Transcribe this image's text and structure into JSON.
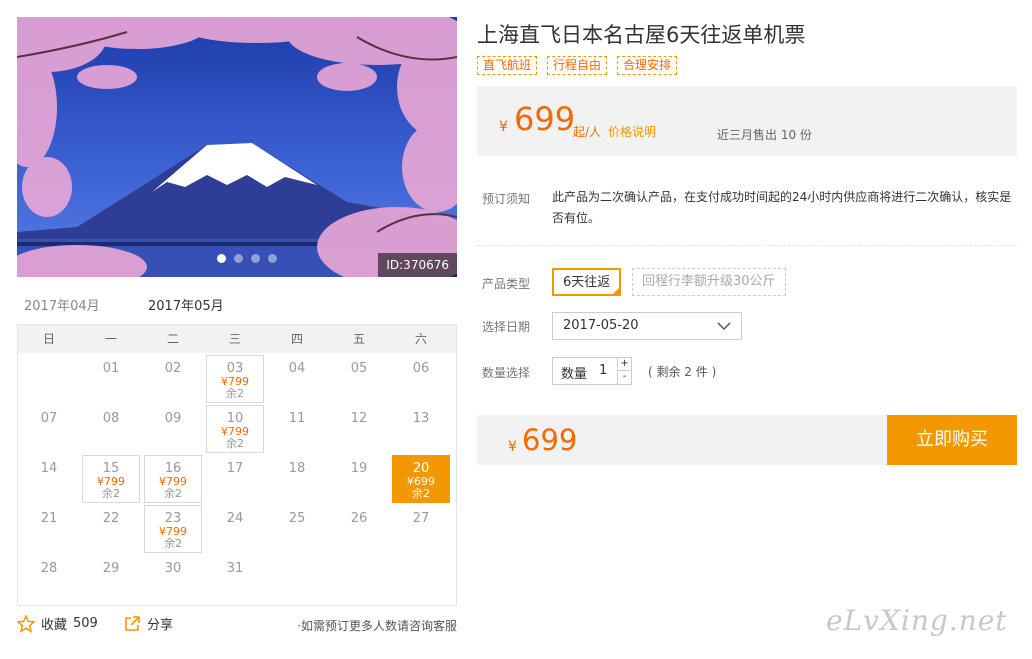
{
  "hero": {
    "image_id": "ID:370676",
    "slide_count": 4,
    "active_slide": 0
  },
  "months": [
    "2017年04月",
    "2017年05月"
  ],
  "active_month": 1,
  "weekdays": [
    "日",
    "一",
    "二",
    "三",
    "四",
    "五",
    "六"
  ],
  "calendar": {
    "days": [
      {
        "d": "01"
      },
      {
        "d": "02"
      },
      {
        "d": "03",
        "price": "¥799",
        "remain": "余2"
      },
      {
        "d": "04"
      },
      {
        "d": "05"
      },
      {
        "d": "06"
      },
      {
        "d": "07"
      },
      {
        "d": "08"
      },
      {
        "d": "09"
      },
      {
        "d": "10",
        "price": "¥799",
        "remain": "余2"
      },
      {
        "d": "11"
      },
      {
        "d": "12"
      },
      {
        "d": "13"
      },
      {
        "d": "14"
      },
      {
        "d": "15",
        "price": "¥799",
        "remain": "余2"
      },
      {
        "d": "16",
        "price": "¥799",
        "remain": "余2"
      },
      {
        "d": "17"
      },
      {
        "d": "18"
      },
      {
        "d": "19"
      },
      {
        "d": "20",
        "price": "¥699",
        "remain": "余2",
        "selected": true
      },
      {
        "d": "21"
      },
      {
        "d": "22"
      },
      {
        "d": "23",
        "price": "¥799",
        "remain": "余2"
      },
      {
        "d": "24"
      },
      {
        "d": "25"
      },
      {
        "d": "26"
      },
      {
        "d": "27"
      },
      {
        "d": "28"
      },
      {
        "d": "29"
      },
      {
        "d": "30"
      },
      {
        "d": "31"
      }
    ]
  },
  "bottom": {
    "favorite_label": "收藏",
    "favorite_count": "509",
    "share_label": "分享",
    "note": "·如需预订更多人数请咨询客服"
  },
  "product": {
    "title": "上海直飞日本名古屋6天往返单机票",
    "tags": [
      "直飞航班",
      "行程自由",
      "合理安排"
    ],
    "currency": "¥",
    "price": "699",
    "unit": "起/人",
    "price_explain": "价格说明",
    "sold": "近三月售出 10 份"
  },
  "booking": {
    "notice_label": "预订须知",
    "notice_text": "此产品为二次确认产品，在支付成功时间起的24小时内供应商将进行二次确认，核实是否有位。",
    "type_label": "产品类型",
    "type_selected": "6天往返",
    "type_disabled": "回程行李额升级30公斤",
    "date_label": "选择日期",
    "date_value": "2017-05-20",
    "qty_label": "数量选择",
    "qty_field_label": "数量",
    "qty_value": "1",
    "qty_plus": "+",
    "qty_minus": "-",
    "remain_text": "( 剩余 2 件 )",
    "total_currency": "¥",
    "total_price": "699",
    "buy_label": "立即购买"
  },
  "watermark": "eLvXing.net",
  "colors": {
    "accent": "#f39800",
    "price": "#f56a00"
  }
}
